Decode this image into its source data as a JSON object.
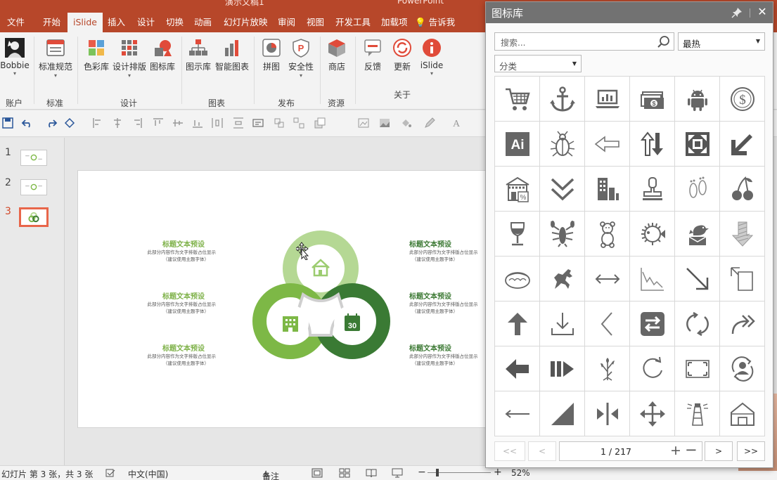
{
  "titlebar": {
    "doc": "演示文稿1",
    "app": "PowerPoint"
  },
  "tabs": [
    "文件",
    "开始",
    "iSlide",
    "插入",
    "设计",
    "切换",
    "动画",
    "幻灯片放映",
    "审阅",
    "视图",
    "开发工具",
    "加载项"
  ],
  "active_tab": "iSlide",
  "tellme": "告诉我",
  "ribbon": {
    "buttons": [
      {
        "label": "Bobbie",
        "icon": "avatar-icon"
      },
      {
        "label": "标准规范",
        "icon": "layout-icon"
      },
      {
        "label": "色彩库",
        "icon": "palette-icon"
      },
      {
        "label": "设计排版",
        "icon": "grid-layout-icon"
      },
      {
        "label": "图标库",
        "icon": "shapes-icon"
      },
      {
        "label": "图示库",
        "icon": "org-chart-icon"
      },
      {
        "label": "智能图表",
        "icon": "bar-chart-icon"
      },
      {
        "label": "拼图",
        "icon": "puzzle-icon"
      },
      {
        "label": "安全性",
        "icon": "shield-p-icon"
      },
      {
        "label": "商店",
        "icon": "cube-icon"
      },
      {
        "label": "反馈",
        "icon": "feedback-icon"
      },
      {
        "label": "更新",
        "icon": "refresh-icon"
      },
      {
        "label": "iSlide",
        "icon": "info-icon"
      }
    ],
    "groups": [
      "账户",
      "标准",
      "设计",
      "图表",
      "发布",
      "资源",
      "关于"
    ]
  },
  "thumbnails": [
    "1",
    "2",
    "3"
  ],
  "slide": {
    "blocks": [
      {
        "heading": "标题文本预设",
        "line1": "此部分内容作为文字排版占位显示",
        "line2": "（建议使用主题字体）"
      },
      {
        "heading": "标题文本预设",
        "line1": "此部分内容作为文字排版占位显示",
        "line2": "（建议使用主题字体）"
      },
      {
        "heading": "标题文本预设",
        "line1": "此部分内容作为文字排版占位显示",
        "line2": "（建议使用主题字体）"
      },
      {
        "heading": "标题文本预设",
        "line1": "此部分内容作为文字排版占位显示",
        "line2": "（建议使用主题字体）"
      },
      {
        "heading": "标题文本预设",
        "line1": "此部分内容作为文字排版占位显示",
        "line2": "（建议使用主题字体）"
      },
      {
        "heading": "标题文本预设",
        "line1": "此部分内容作为文字排版占位显示",
        "line2": "（建议使用主题字体）"
      }
    ],
    "calendar_day": "30",
    "colors": {
      "light": "#b5d894",
      "mid": "#7db846",
      "dark": "#3a7a34"
    }
  },
  "status": {
    "slide_info": "幻灯片 第 3 张，共 3 张",
    "language": "中文(中国)",
    "notes": "备注",
    "zoom": "52%"
  },
  "panel": {
    "title": "图标库",
    "search_placeholder": "搜索...",
    "sort": "最热",
    "category": "分类",
    "icons": [
      "shopping-cart-icon",
      "anchor-icon",
      "laptop-chart-icon",
      "money-icon",
      "android-icon",
      "dollar-coin-icon",
      "ai-logo-icon",
      "beetle-icon",
      "arrow-left-outline-icon",
      "arrows-up-down-icon",
      "expand-square-icon",
      "arrow-down-left-icon",
      "store-percent-icon",
      "double-chevron-down-icon",
      "buildings-icon",
      "stamp-icon",
      "footprints-icon",
      "cherries-icon",
      "wine-glass-icon",
      "lobster-icon",
      "teddy-bear-icon",
      "pufferfish-icon",
      "bird-mail-icon",
      "down-arrow-hatched-icon",
      "dumpling-icon",
      "horse-icon",
      "arrow-left-right-icon",
      "line-chart-down-icon",
      "arrow-down-right-icon",
      "resize-page-icon",
      "arrow-up-icon",
      "download-icon",
      "chevron-left-icon",
      "swap-box-icon",
      "refresh-circle-icon",
      "share-forward-icon",
      "arrow-left-bold-icon",
      "fast-forward-icon",
      "plant-icon",
      "rotate-cw-icon",
      "screen-frame-icon",
      "user-refresh-icon",
      "long-arrow-left-icon",
      "triangle-corner-icon",
      "split-arrows-icon",
      "move-arrows-icon",
      "lighthouse-icon",
      "house-outline-icon"
    ],
    "page": {
      "first": "<<",
      "prev": "<",
      "current": "1 / 217",
      "next": ">",
      "last": ">>"
    }
  }
}
